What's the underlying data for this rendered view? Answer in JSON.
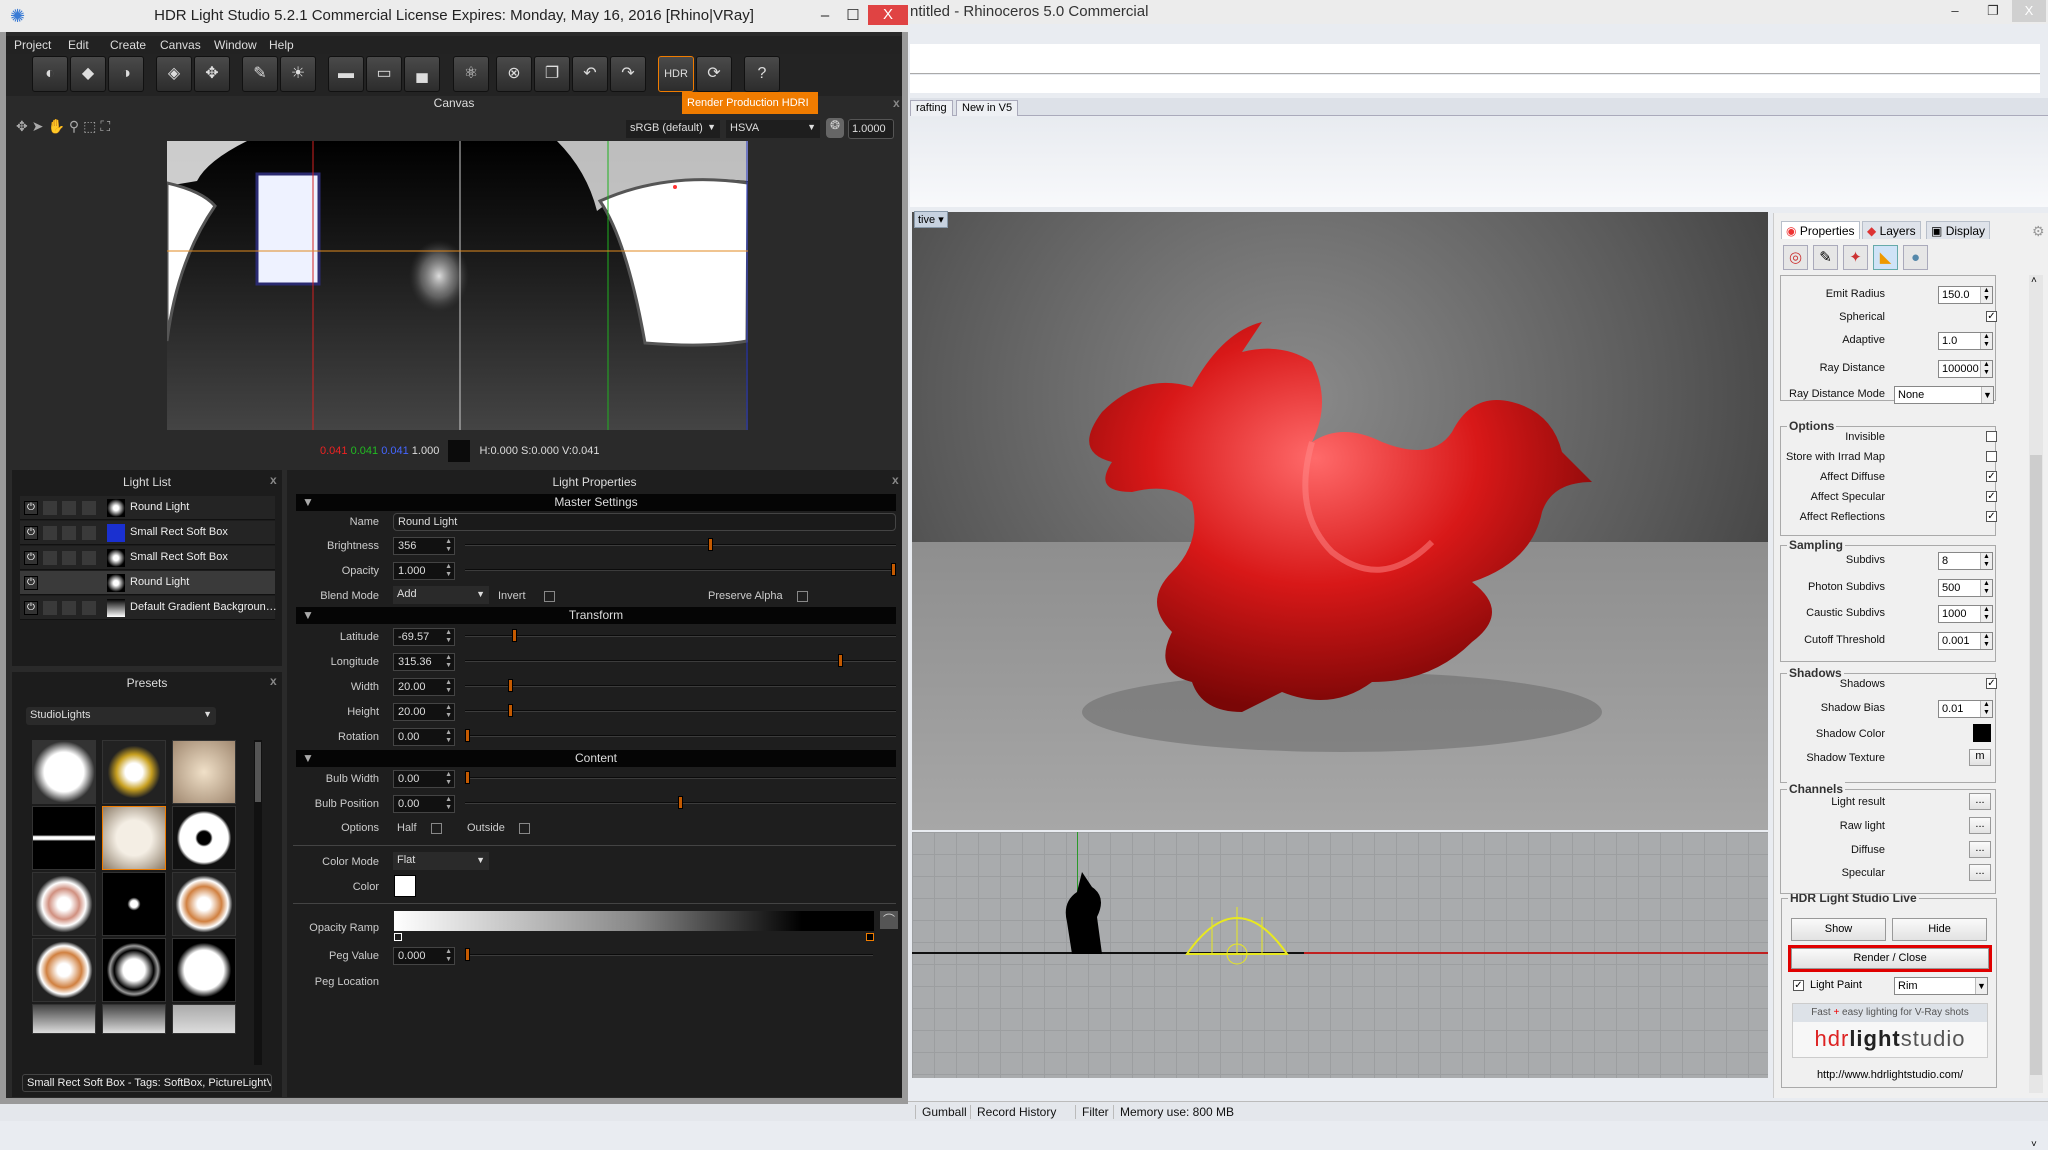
{
  "hdr_window": {
    "title": "HDR Light Studio 5.2.1 Commercial License Expires: Monday, May 16, 2016  [Rhino|VRay]",
    "controls": {
      "minimize": "‒",
      "maximize": "☐",
      "close": "X"
    },
    "menu": [
      "Project",
      "Edit",
      "Create",
      "Canvas",
      "Window",
      "Help"
    ],
    "toolbar_icons": [
      "add-round-light-icon",
      "add-rect-light-icon",
      "add-soft-light-icon",
      "add-diamond-light-icon",
      "add-pattern-light-icon",
      "light-paint-icon",
      "sun-icon",
      "gradient-bg-icon",
      "hdri-bg-icon",
      "horizon-bg-icon",
      "atom-icon",
      "delete-icon",
      "duplicate-icon",
      "undo-icon",
      "redo-icon",
      "hdr-icon",
      "hdr-refresh-icon",
      "help-icon"
    ],
    "tooltip": "Render Production HDRI",
    "canvas": {
      "title": "Canvas",
      "colorspace": "sRGB (default)",
      "color_model": "HSVA",
      "exposure": "1.0000",
      "readout_r": "0.041",
      "readout_g": "0.041",
      "readout_b": "0.041",
      "readout_a": "1.000",
      "readout_hsv": "H:0.000 S:0.000 V:0.041"
    },
    "light_list": {
      "title": "Light List",
      "items": [
        {
          "name": "Round Light",
          "selected": false
        },
        {
          "name": "Small Rect Soft Box",
          "selected": false
        },
        {
          "name": "Small Rect Soft Box",
          "selected": false
        },
        {
          "name": "Round Light",
          "selected": true
        },
        {
          "name": "Default Gradient Backgroun…",
          "selected": false
        }
      ]
    },
    "presets": {
      "title": "Presets",
      "category": "StudioLights",
      "caption": "Small Rect Soft Box - Tags: SoftBox, PictureLightV"
    },
    "light_properties": {
      "title": "Light Properties",
      "master_header": "Master Settings",
      "name_label": "Name",
      "name_value": "Round Light",
      "brightness": {
        "label": "Brightness",
        "value": "356",
        "slider": 0.57
      },
      "opacity": {
        "label": "Opacity",
        "value": "1.000",
        "slider": 1.0
      },
      "blend_label": "Blend Mode",
      "blend_value": "Add",
      "invert_label": "Invert",
      "preserve_alpha_label": "Preserve Alpha",
      "transform_header": "Transform",
      "latitude": {
        "label": "Latitude",
        "value": "-69.57",
        "slider": 0.11
      },
      "longitude": {
        "label": "Longitude",
        "value": "315.36",
        "slider": 0.876
      },
      "width": {
        "label": "Width",
        "value": "20.00",
        "slider": 0.1
      },
      "height": {
        "label": "Height",
        "value": "20.00",
        "slider": 0.1
      },
      "rotation": {
        "label": "Rotation",
        "value": "0.00",
        "slider": 0.0
      },
      "content_header": "Content",
      "bulb_width": {
        "label": "Bulb Width",
        "value": "0.00",
        "slider": 0.0
      },
      "bulb_position": {
        "label": "Bulb Position",
        "value": "0.00",
        "slider": 0.5
      },
      "options_label": "Options",
      "half_label": "Half",
      "outside_label": "Outside",
      "color_mode_label": "Color Mode",
      "color_mode_value": "Flat",
      "color_label": "Color",
      "color_value": "#ffffff",
      "opacity_ramp_label": "Opacity Ramp",
      "peg_value": {
        "label": "Peg Value",
        "value": "0.000",
        "slider": 0.0
      },
      "peg_location_label": "Peg Location"
    }
  },
  "rhino": {
    "title": "ntitled - Rhinoceros 5.0 Commercial",
    "controls": {
      "minimize": "‒",
      "restore": "❐",
      "close": "X"
    },
    "tabs": [
      "rafting",
      "New in V5"
    ],
    "viewport_label": "tive",
    "status": [
      "Gumball",
      "Record History",
      "Filter",
      "Memory use: 800 MB"
    ],
    "panel": {
      "tabs": [
        "Properties",
        "Layers",
        "Display"
      ],
      "rows": [
        {
          "label": "Emit Radius",
          "type": "num",
          "value": "150.0"
        },
        {
          "label": "Spherical",
          "type": "chk",
          "value": true
        },
        {
          "label": "Adaptive",
          "type": "num",
          "value": "1.0"
        },
        {
          "label": "Ray Distance",
          "type": "num",
          "value": "100000"
        },
        {
          "label": "Ray Distance Mode",
          "type": "sel",
          "value": "None"
        }
      ],
      "groups": [
        {
          "title": "Options",
          "rows": [
            {
              "label": "Invisible",
              "type": "chk",
              "value": false
            },
            {
              "label": "Store with Irrad Map",
              "type": "chk",
              "value": false
            },
            {
              "label": "Affect Diffuse",
              "type": "chk",
              "value": true
            },
            {
              "label": "Affect Specular",
              "type": "chk",
              "value": true
            },
            {
              "label": "Affect Reflections",
              "type": "chk",
              "value": true
            }
          ]
        },
        {
          "title": "Sampling",
          "rows": [
            {
              "label": "Subdivs",
              "type": "num",
              "value": "8"
            },
            {
              "label": "Photon Subdivs",
              "type": "num",
              "value": "500"
            },
            {
              "label": "Caustic Subdivs",
              "type": "num",
              "value": "1000"
            },
            {
              "label": "Cutoff Threshold",
              "type": "num",
              "value": "0.001"
            }
          ]
        },
        {
          "title": "Shadows",
          "rows": [
            {
              "label": "Shadows",
              "type": "chk",
              "value": true
            },
            {
              "label": "Shadow Bias",
              "type": "num",
              "value": "0.01"
            },
            {
              "label": "Shadow Color",
              "type": "color",
              "value": "#000000"
            },
            {
              "label": "Shadow Texture",
              "type": "btn",
              "value": "m"
            }
          ]
        },
        {
          "title": "Channels",
          "rows": [
            {
              "label": "Light result",
              "type": "btn",
              "value": "..."
            },
            {
              "label": "Raw light",
              "type": "btn",
              "value": "..."
            },
            {
              "label": "Diffuse",
              "type": "btn",
              "value": "..."
            },
            {
              "label": "Specular",
              "type": "btn",
              "value": "..."
            }
          ]
        }
      ],
      "live": {
        "title": "HDR Light Studio Live",
        "show": "Show",
        "hide": "Hide",
        "render_close": "Render / Close",
        "light_paint_label": "Light Paint",
        "light_paint_checked": true,
        "light_paint_mode": "Rim",
        "tagline_a": "Fast ",
        "tagline_plus": "+",
        "tagline_b": " easy lighting for V-Ray shots",
        "logo": "hdrlightstudio",
        "url": "http://www.hdrlightstudio.com/"
      }
    }
  },
  "colors": {
    "accent_orange": "#f07c00",
    "render_highlight": "#e00000",
    "dragon": "#d81818"
  }
}
